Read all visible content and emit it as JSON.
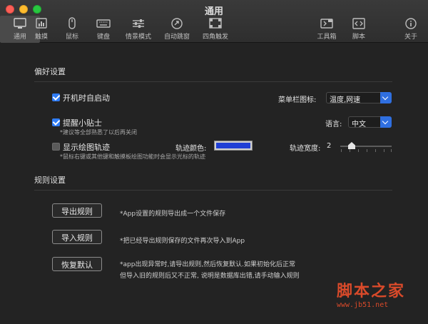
{
  "window": {
    "title": "通用"
  },
  "toolbar": {
    "items": [
      {
        "label": "通用",
        "icon": "general-icon",
        "active": true
      },
      {
        "label": "触摸",
        "icon": "touch-icon"
      },
      {
        "label": "鼠标",
        "icon": "mouse-icon"
      },
      {
        "label": "键盘",
        "icon": "keyboard-icon"
      },
      {
        "label": "情景模式",
        "icon": "sliders-icon"
      },
      {
        "label": "自动跳窗",
        "icon": "auto-jump-icon"
      },
      {
        "label": "四角触发",
        "icon": "corners-icon"
      },
      {
        "label": "工具箱",
        "icon": "toolbox-icon"
      },
      {
        "label": "脚本",
        "icon": "script-icon"
      },
      {
        "label": "关于",
        "icon": "info-icon"
      }
    ]
  },
  "preferences": {
    "title": "偏好设置",
    "launch_at_login": {
      "label": "开机时自启动",
      "checked": true
    },
    "menubar_icon": {
      "label": "菜单栏图标:",
      "value": "温度,网速"
    },
    "tips": {
      "label": "提醒小贴士",
      "checked": true,
      "note": "*建议等全部熟悉了以后再关闭"
    },
    "language": {
      "label": "语言:",
      "value": "中文"
    },
    "show_trail": {
      "label": "显示绘图轨迹",
      "checked": false,
      "note": "*鼠标右键或其他键和触摸板绘图功能时会显示光标的轨迹"
    },
    "trail_color": {
      "label": "轨迹颜色:",
      "color": "#1f3fd6"
    },
    "trail_width": {
      "label": "轨迹宽度:",
      "value": "2",
      "level": 2
    }
  },
  "rules": {
    "title": "规则设置",
    "export": {
      "button": "导出规则",
      "note": "*App设置的规则导出成一个文件保存"
    },
    "import": {
      "button": "导入规则",
      "note": "*把已经导出规则保存的文件再次导入到App"
    },
    "restore": {
      "button": "恢复默认",
      "note_line1": "*app出现异常时,请导出规则,然后恢复默认.如果初始化后正常",
      "note_line2": "但导入旧的规则后又不正常, 说明是数据库出错,请手动输入规则"
    }
  },
  "watermark": {
    "text": "脚本之家",
    "url": "www.jb51.net"
  }
}
